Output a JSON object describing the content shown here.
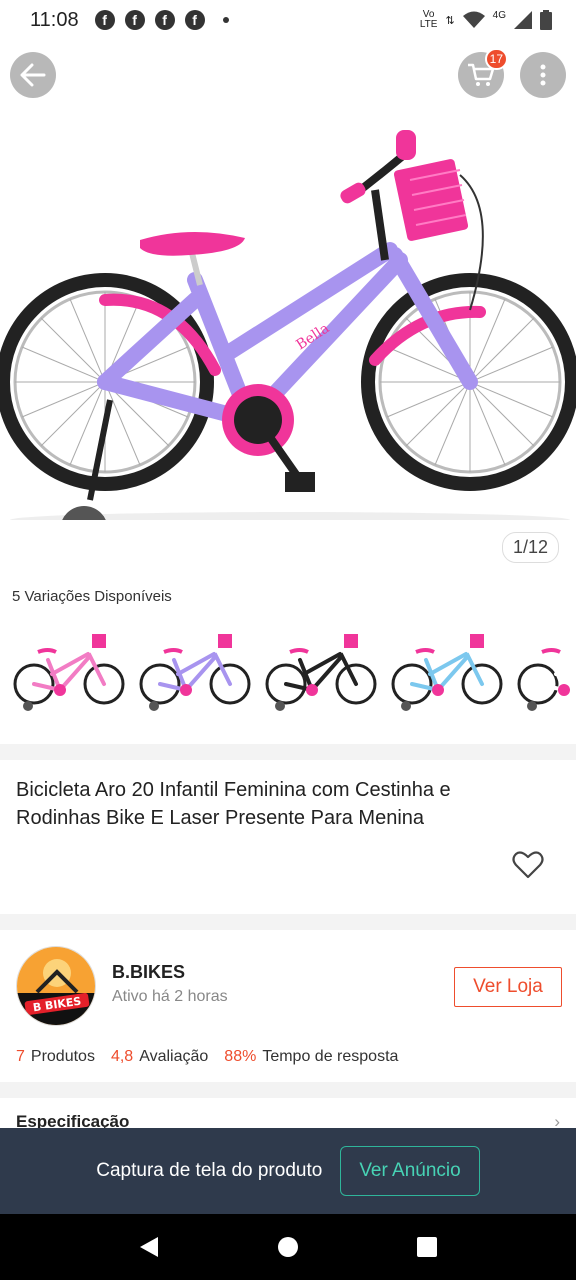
{
  "status_bar": {
    "time": "11:08",
    "notification_icons": [
      "facebook-icon",
      "facebook-icon",
      "facebook-icon",
      "facebook-icon"
    ],
    "network_labels": [
      "Vo",
      "LTE",
      "4G"
    ]
  },
  "header": {
    "cart_count": "17"
  },
  "gallery": {
    "counter": "1/12"
  },
  "variations": {
    "title": "5 Variações Disponíveis",
    "items": [
      {
        "color": "#f27cc4"
      },
      {
        "color": "#a894ef"
      },
      {
        "color": "#222222"
      },
      {
        "color": "#7cc8ee"
      },
      {
        "color": "#ffffff"
      }
    ]
  },
  "product": {
    "title": "Bicicleta Aro 20 Infantil Feminina com Cestinha e Rodinhas Bike E Laser Presente Para Menina"
  },
  "shop": {
    "logo_text": "B BIKES",
    "name": "B.BIKES",
    "active": "Ativo há 2 horas",
    "visit_label": "Ver Loja",
    "stats": [
      {
        "value": "7",
        "label": "Produtos"
      },
      {
        "value": "4,8",
        "label": "Avaliação"
      },
      {
        "value": "88%",
        "label": "Tempo de resposta"
      }
    ]
  },
  "spec": {
    "label": "Especificação"
  },
  "banner": {
    "text": "Captura de tela do produto",
    "button": "Ver Anúncio"
  },
  "colors": {
    "accent": "#ee4d2d",
    "banner_bg": "#2f3a4c",
    "banner_button": "#47d3b5",
    "bike_frame": "#a894ef",
    "bike_pink": "#f0359a"
  }
}
